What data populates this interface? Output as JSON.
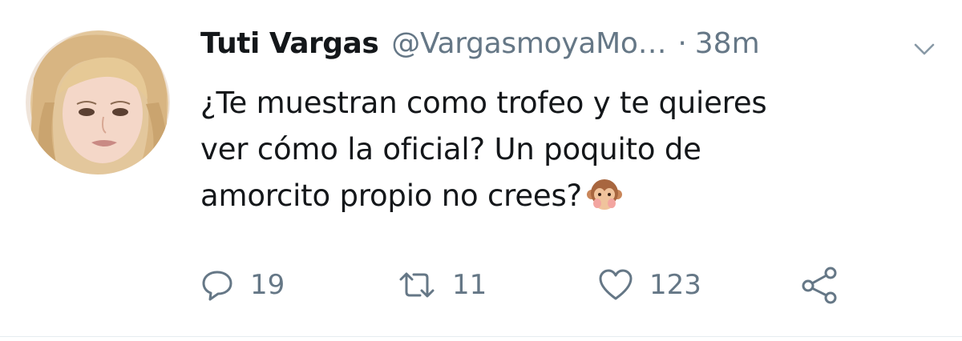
{
  "tweet": {
    "author_name": "Tuti Vargas",
    "author_handle": "@VargasmoyaMo…",
    "separator": "·",
    "timestamp": "38m",
    "text_lines": [
      "¿Te muestran como trofeo y te quieres",
      "ver cómo la oficial? Un poquito de",
      "amorcito propio no crees?"
    ],
    "emoji": "monkey-face-emoji"
  },
  "actions": {
    "reply_count": "19",
    "retweet_count": "11",
    "like_count": "123",
    "reply_icon": "reply-icon",
    "retweet_icon": "retweet-icon",
    "like_icon": "heart-icon",
    "share_icon": "share-icon"
  },
  "colors": {
    "text_primary": "#14171a",
    "text_secondary": "#657786",
    "divider": "#e6ecf0"
  }
}
